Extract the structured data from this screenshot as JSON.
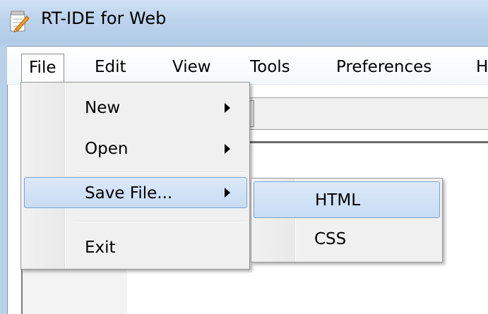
{
  "window": {
    "title": "RT-IDE for Web",
    "icon": "notepad-pencil-icon"
  },
  "menubar": {
    "items": [
      {
        "label": "File",
        "active": true
      },
      {
        "label": "Edit"
      },
      {
        "label": "View"
      },
      {
        "label": "Tools"
      },
      {
        "label": "Preferences"
      },
      {
        "label": "H"
      }
    ]
  },
  "file_menu": {
    "items": [
      {
        "label": "New",
        "submenu": true
      },
      {
        "label": "Open",
        "submenu": true
      },
      {
        "label": "Save File...",
        "submenu": true,
        "highlighted": true
      },
      {
        "label": "Exit"
      }
    ]
  },
  "save_submenu": {
    "items": [
      {
        "label": "HTML",
        "highlighted": true
      },
      {
        "label": "CSS"
      }
    ]
  },
  "colors": {
    "titlebar": "#bcd3ec",
    "menu_background": "#f0f0f0",
    "highlight": "#c7dcf4",
    "highlight_border": "#7da2ce"
  }
}
